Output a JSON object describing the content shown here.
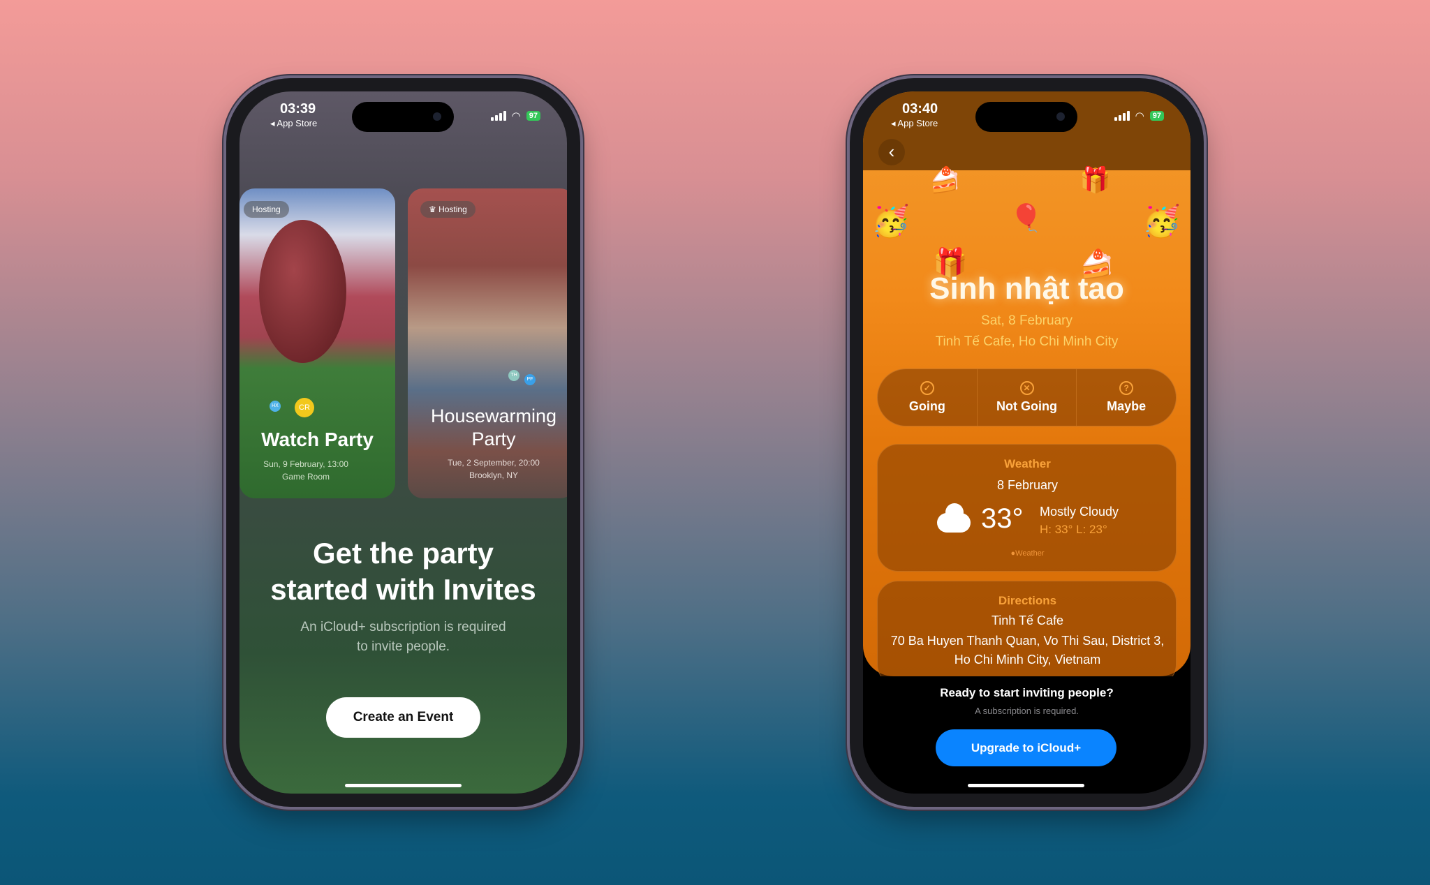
{
  "left_phone": {
    "status": {
      "time": "03:39",
      "back_app": "◂ App Store",
      "battery": "97"
    },
    "cards": [
      {
        "badge": "Hosting",
        "title": "Watch Party",
        "date": "Sun, 9 February, 13:00",
        "location": "Game Room",
        "avatar_initials": [
          "HX",
          "CR"
        ]
      },
      {
        "badge": "Hosting",
        "title": "Housewarming Party",
        "date": "Tue, 2 September, 20:00",
        "location": "Brooklyn, NY",
        "avatar_initials": [
          "TH",
          "PF"
        ]
      }
    ],
    "headline": "Get the party started with Invites",
    "subtitle": "An iCloud+ subscription is required to invite people.",
    "cta": "Create an Event"
  },
  "right_phone": {
    "status": {
      "time": "03:40",
      "back_app": "◂ App Store",
      "battery": "97"
    },
    "event": {
      "title": "Sinh nhật tao",
      "date": "Sat, 8 February",
      "location": "Tinh Tế Cafe, Ho Chi Minh City"
    },
    "rsvp": [
      {
        "label": "Going",
        "icon": "check-circle"
      },
      {
        "label": "Not Going",
        "icon": "x-circle"
      },
      {
        "label": "Maybe",
        "icon": "question-circle"
      }
    ],
    "weather": {
      "heading": "Weather",
      "date": "8 February",
      "temp": "33°",
      "condition": "Mostly Cloudy",
      "hilo": "H: 33° L: 23°",
      "attribution": "Weather",
      "icon": "cloud"
    },
    "directions": {
      "heading": "Directions",
      "place": "Tinh Tế Cafe",
      "address": "70 Ba Huyen Thanh Quan, Vo Thi Sau, District 3, Ho Chi Minh City, Vietnam"
    },
    "prompt": "Ready to start inviting people?",
    "prompt_sub": "A subscription is required.",
    "cta": "Upgrade to iCloud+"
  },
  "colors": {
    "accent_orange": "#f08a1c",
    "cta_blue": "#0a84ff",
    "battery_green": "#34c759"
  }
}
